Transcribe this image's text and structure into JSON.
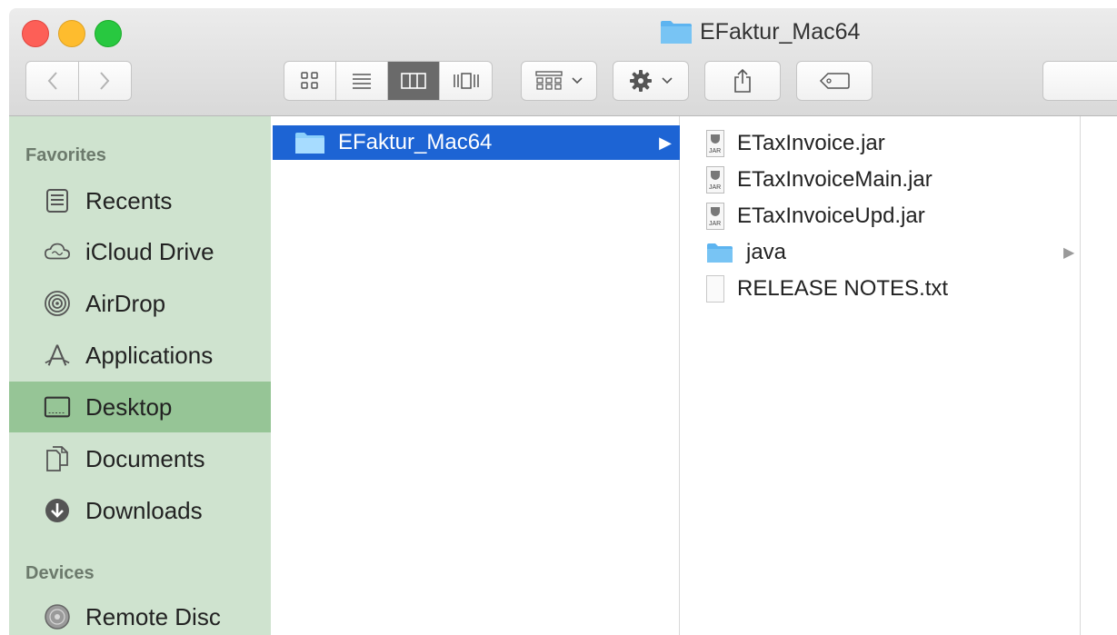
{
  "window": {
    "title": "EFaktur_Mac64"
  },
  "toolbar": {
    "back_icon": "chevron-left-icon",
    "forward_icon": "chevron-right-icon",
    "views": [
      "icon-view",
      "list-view",
      "column-view",
      "cover-flow-view"
    ],
    "active_view": "column-view",
    "arrange_icon": "arrange-icon",
    "action_icon": "gear-icon",
    "share_icon": "share-icon",
    "tags_icon": "tag-icon"
  },
  "sidebar": {
    "favorites_heading": "Favorites",
    "items": [
      {
        "label": "Recents",
        "icon": "recents-icon"
      },
      {
        "label": "iCloud Drive",
        "icon": "icloud-icon"
      },
      {
        "label": "AirDrop",
        "icon": "airdrop-icon"
      },
      {
        "label": "Applications",
        "icon": "applications-icon"
      },
      {
        "label": "Desktop",
        "icon": "desktop-icon",
        "selected": true
      },
      {
        "label": "Documents",
        "icon": "documents-icon"
      },
      {
        "label": "Downloads",
        "icon": "downloads-icon"
      }
    ],
    "devices_heading": "Devices",
    "devices": [
      {
        "label": "Remote Disc",
        "icon": "disc-icon"
      }
    ]
  },
  "column1": {
    "selected_folder": "EFaktur_Mac64"
  },
  "column2": {
    "files": [
      {
        "name": "ETaxInvoice.jar",
        "type": "jar"
      },
      {
        "name": "ETaxInvoiceMain.jar",
        "type": "jar"
      },
      {
        "name": "ETaxInvoiceUpd.jar",
        "type": "jar"
      },
      {
        "name": "java",
        "type": "folder"
      },
      {
        "name": "RELEASE NOTES.txt",
        "type": "txt"
      }
    ],
    "jar_badge": "JAR"
  },
  "colors": {
    "sidebar_bg": "#cfe3cf",
    "sidebar_selected": "#96c596",
    "selection_blue": "#1d64d4",
    "folder_blue": "#5db4f0"
  }
}
